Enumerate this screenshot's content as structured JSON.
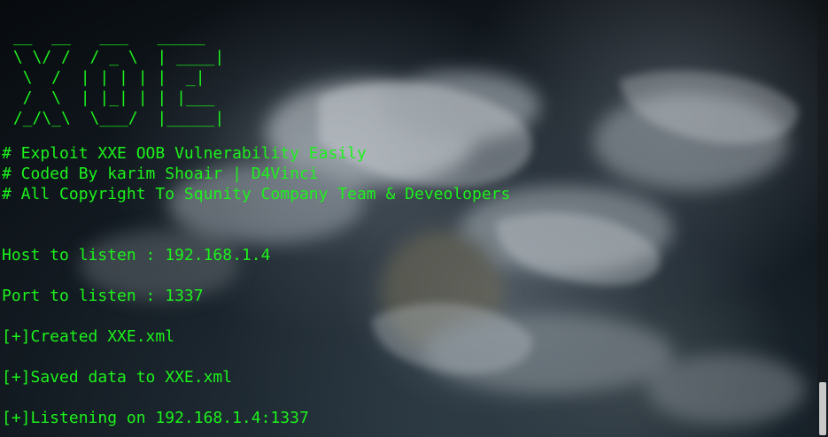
{
  "banner": " __  __   ___   _____\n \\ \\/ /  / _ \\  | ____|\n  \\  /  | | | | |  _|\n  /  \\  | |_| | | |___\n /_/\\_\\  \\___/  |_____|",
  "comments": [
    "# Exploit XXE OOB Vulnerability Easily",
    "# Coded By karim Shoair | D4Vinci",
    "# All Copyright To Squnity Company Team & Deveolopers"
  ],
  "output": [
    "Host to listen : 192.168.1.4",
    "Port to listen : 1337",
    "[+]Created XXE.xml",
    "[+]Saved data to XXE.xml",
    "[+]Listening on 192.168.1.4:1337"
  ],
  "colors": {
    "text": "#1cf21c",
    "scroll_thumb": "#c8c8c8"
  }
}
